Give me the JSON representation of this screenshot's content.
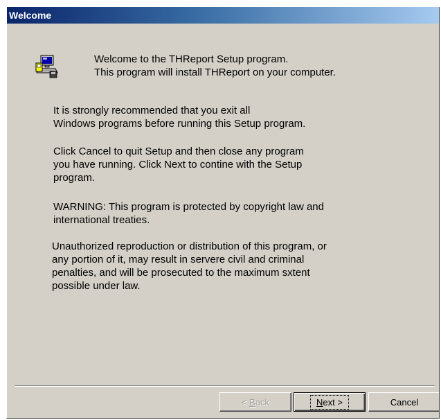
{
  "window": {
    "title": "Welcome"
  },
  "intro": {
    "icon": "setup-computer-icon",
    "text": "Welcome to the THReport Setup program.\nThis program will install THReport on your computer."
  },
  "paragraphs": [
    "It is strongly recommended that you exit all\nWindows programs before running this Setup program.",
    "Click Cancel to quit Setup and then close any program\nyou have running. Click Next to contine with the Setup\nprogram.",
    "WARNING:  This program is protected by copyright law and\ninternational treaties.",
    "Unauthorized reproduction or distribution of this program, or\nany portion of it, may result in servere civil and criminal\npenalties, and will be prosecuted to the maximum sxtent\npossible under law."
  ],
  "buttons": {
    "back_prefix": "< ",
    "back_mnemonic": "B",
    "back_rest": "ack",
    "back_enabled": false,
    "next_mnemonic": "N",
    "next_rest": "ext >",
    "cancel_label": "Cancel"
  },
  "colors": {
    "dialog_face": "#d4d0c8",
    "title_gradient_start": "#0a246a",
    "title_gradient_end": "#a6caf0"
  }
}
